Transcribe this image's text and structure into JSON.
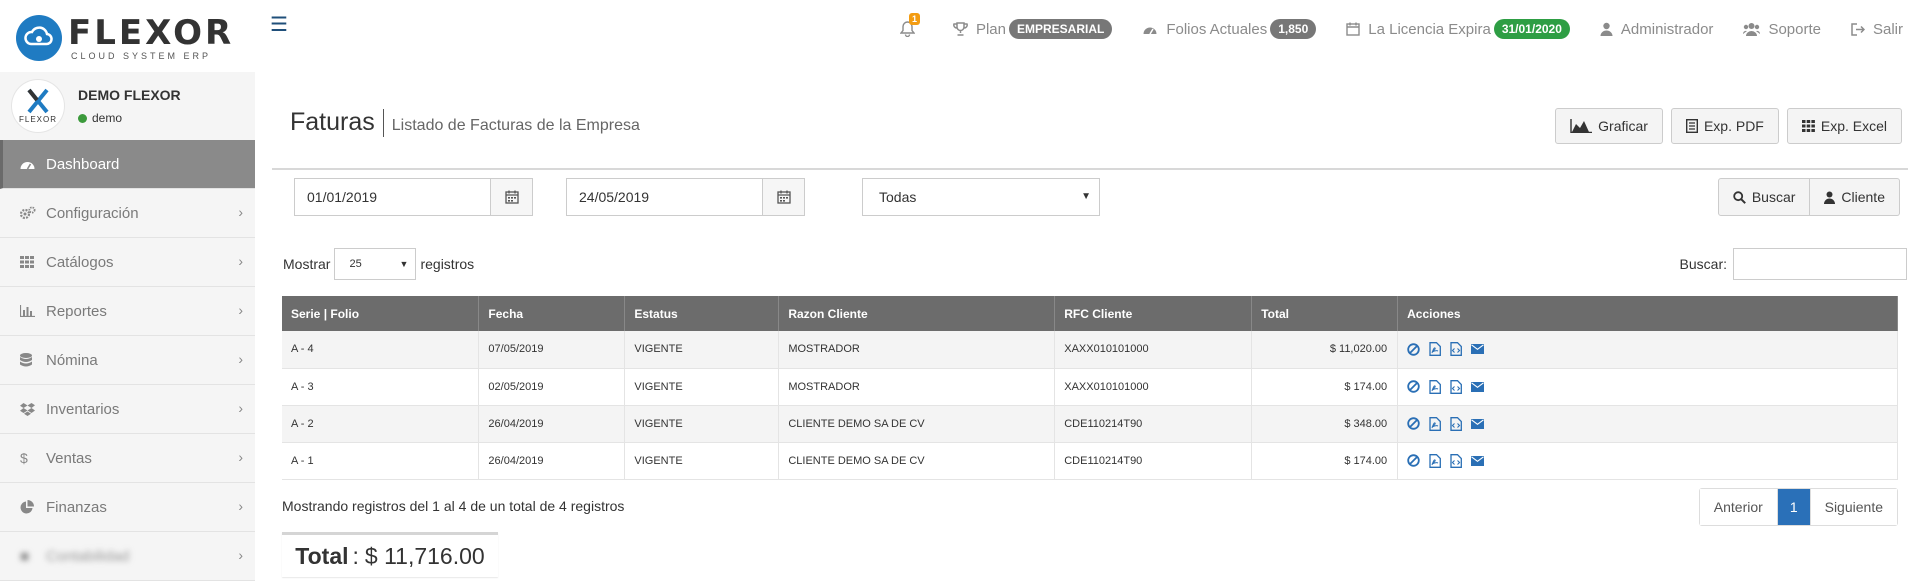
{
  "brand": {
    "name": "FLEXOR",
    "tagline": "CLOUD SYSTEM ERP"
  },
  "topnav": {
    "notification_count": "1",
    "plan_label": "Plan",
    "plan_badge": "EMPRESARIAL",
    "folios_label": "Folios Actuales",
    "folios_badge": "1,850",
    "license_label": "La Licencia Expira",
    "license_badge": "31/01/2020",
    "admin_label": "Administrador",
    "support_label": "Soporte",
    "exit_label": "Salir"
  },
  "profile": {
    "avatar_text": "FLEXOR",
    "name": "DEMO FLEXOR",
    "status": "demo"
  },
  "sidebar": {
    "items": [
      {
        "label": "Dashboard",
        "icon": "dashboard-icon"
      },
      {
        "label": "Configuración",
        "icon": "cogs-icon"
      },
      {
        "label": "Catálogos",
        "icon": "grid-icon"
      },
      {
        "label": "Reportes",
        "icon": "bar-chart-icon"
      },
      {
        "label": "Nómina",
        "icon": "database-icon"
      },
      {
        "label": "Inventarios",
        "icon": "dropbox-icon"
      },
      {
        "label": "Ventas",
        "icon": "dollar-icon"
      },
      {
        "label": "Finanzas",
        "icon": "pie-chart-icon"
      },
      {
        "label": "Contabilidad",
        "icon": "blurred-icon"
      }
    ]
  },
  "page": {
    "title": "Faturas",
    "subtitle": "Listado de Facturas de la Empresa",
    "graph_button": "Graficar",
    "pdf_button": "Exp. PDF",
    "excel_button": "Exp. Excel"
  },
  "filters": {
    "date_from": "01/01/2019",
    "date_to": "24/05/2019",
    "status_select": "Todas",
    "search_button": "Buscar",
    "client_button": "Cliente"
  },
  "table_controls": {
    "show_label": "Mostrar",
    "page_length": "25",
    "records_label": "registros",
    "search_label": "Buscar:",
    "search_value": ""
  },
  "table": {
    "columns": [
      "Serie | Folio",
      "Fecha",
      "Estatus",
      "Razon Cliente",
      "RFC Cliente",
      "Total",
      "Acciones"
    ],
    "rows": [
      {
        "folio": "A - 4",
        "fecha": "07/05/2019",
        "estatus": "VIGENTE",
        "cliente": "MOSTRADOR",
        "rfc": "XAXX010101000",
        "total": "$ 11,020.00"
      },
      {
        "folio": "A - 3",
        "fecha": "02/05/2019",
        "estatus": "VIGENTE",
        "cliente": "MOSTRADOR",
        "rfc": "XAXX010101000",
        "total": "$ 174.00"
      },
      {
        "folio": "A - 2",
        "fecha": "26/04/2019",
        "estatus": "VIGENTE",
        "cliente": "CLIENTE DEMO SA DE CV",
        "rfc": "CDE110214T90",
        "total": "$ 348.00"
      },
      {
        "folio": "A - 1",
        "fecha": "26/04/2019",
        "estatus": "VIGENTE",
        "cliente": "CLIENTE DEMO SA DE CV",
        "rfc": "CDE110214T90",
        "total": "$ 174.00"
      }
    ]
  },
  "footer": {
    "info": "Mostrando registros del 1 al 4 de un total de 4 registros",
    "prev": "Anterior",
    "current_page": "1",
    "next": "Siguiente",
    "total_label": "Total",
    "total_sep": ":",
    "total_value": "$ 11,716.00"
  },
  "colors": {
    "accent": "#2a70b8",
    "sidebar_active": "#8a8a8a",
    "table_header": "#6c6c6c",
    "badge_green": "#2e9e44",
    "badge_gray": "#777777"
  }
}
